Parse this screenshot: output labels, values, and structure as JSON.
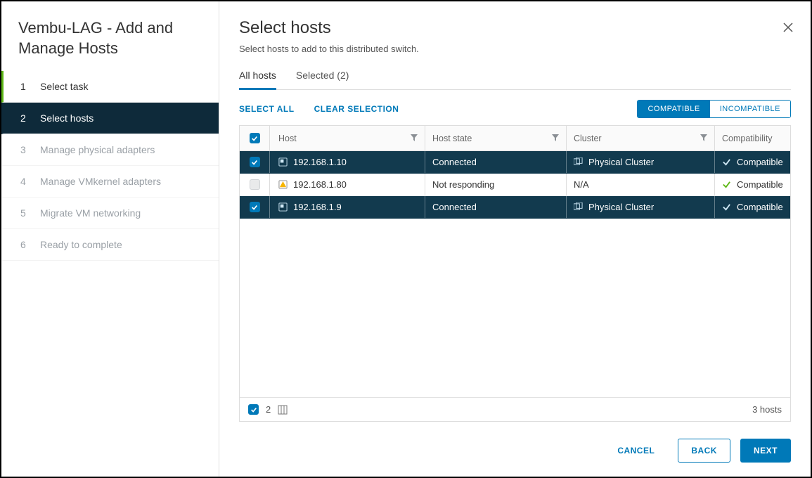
{
  "wizard": {
    "title": "Vembu-LAG - Add and Manage Hosts",
    "steps": [
      {
        "num": "1",
        "label": "Select task"
      },
      {
        "num": "2",
        "label": "Select hosts"
      },
      {
        "num": "3",
        "label": "Manage physical adapters"
      },
      {
        "num": "4",
        "label": "Manage VMkernel adapters"
      },
      {
        "num": "5",
        "label": "Migrate VM networking"
      },
      {
        "num": "6",
        "label": "Ready to complete"
      }
    ],
    "active_index": 1
  },
  "page": {
    "heading": "Select hosts",
    "subtitle": "Select hosts to add to this distributed switch."
  },
  "tabs": {
    "all_label": "All hosts",
    "selected_label": "Selected (2)"
  },
  "actions": {
    "select_all": "SELECT ALL",
    "clear": "CLEAR SELECTION",
    "compatible": "COMPATIBLE",
    "incompatible": "INCOMPATIBLE"
  },
  "columns": {
    "host": "Host",
    "state": "Host state",
    "cluster": "Cluster",
    "compat": "Compatibility"
  },
  "hosts": [
    {
      "selected": true,
      "ip": "192.168.1.10",
      "state": "Connected",
      "cluster": "Physical Cluster",
      "compat": "Compatible",
      "warn": false
    },
    {
      "selected": false,
      "ip": "192.168.1.80",
      "state": "Not responding",
      "cluster": "N/A",
      "compat": "Compatible",
      "warn": true
    },
    {
      "selected": true,
      "ip": "192.168.1.9",
      "state": "Connected",
      "cluster": "Physical Cluster",
      "compat": "Compatible",
      "warn": false
    }
  ],
  "footer_bar": {
    "selected_count": "2",
    "total": "3 hosts"
  },
  "buttons": {
    "cancel": "CANCEL",
    "back": "BACK",
    "next": "NEXT"
  }
}
